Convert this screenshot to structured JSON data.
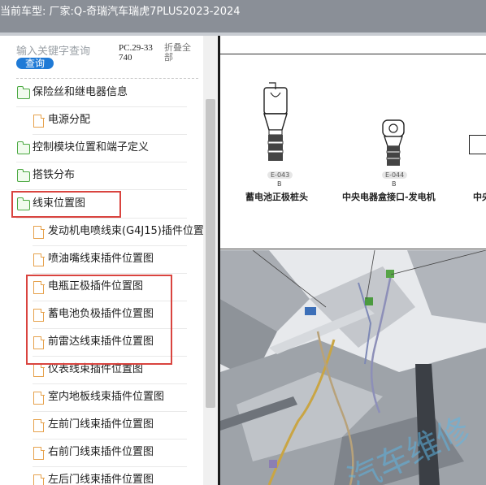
{
  "titlebar": {
    "label": "当前车型:   厂家:Q-奇瑞汽车瑞虎7PLUS2023-2024"
  },
  "search": {
    "placeholder": "输入关键字查询",
    "query_button": "查询"
  },
  "pc_code": "PC.29-33740",
  "collapse_all": "折叠全部",
  "tree": [
    {
      "label": "保险丝和继电器信息",
      "type": "folder"
    },
    {
      "label": "电源分配",
      "type": "doc"
    },
    {
      "label": "控制模块位置和端子定义",
      "type": "folder"
    },
    {
      "label": "搭铁分布",
      "type": "folder"
    },
    {
      "label": "线束位置图",
      "type": "folder-open"
    },
    {
      "label": "发动机电喷线束(G4J15)插件位置图",
      "type": "doc"
    },
    {
      "label": "喷油嘴线束插件位置图",
      "type": "doc"
    },
    {
      "label": "电瓶正极插件位置图",
      "type": "doc"
    },
    {
      "label": "蓄电池负极插件位置图",
      "type": "doc"
    },
    {
      "label": "前雷达线束插件位置图",
      "type": "doc"
    },
    {
      "label": "仪表线束插件位置图",
      "type": "doc"
    },
    {
      "label": "室内地板线束插件位置图",
      "type": "doc"
    },
    {
      "label": "左前门线束插件位置图",
      "type": "doc"
    },
    {
      "label": "右前门线束插件位置图",
      "type": "doc"
    },
    {
      "label": "左后门线束插件位置图",
      "type": "doc"
    }
  ],
  "diagram": {
    "connectors": [
      {
        "code": "E-043",
        "variant": "B",
        "name": "蓄电池正极桩头"
      },
      {
        "code": "E-044",
        "variant": "B",
        "name": "中央电器盒接口-发电机"
      },
      {
        "code": "",
        "variant": "",
        "name": "中央"
      }
    ],
    "watermark": "汽车维修"
  },
  "colors": {
    "highlight": "#d9443f",
    "folder": "#4aa840",
    "doc": "#e6a24d",
    "button": "#1f7ad6"
  }
}
